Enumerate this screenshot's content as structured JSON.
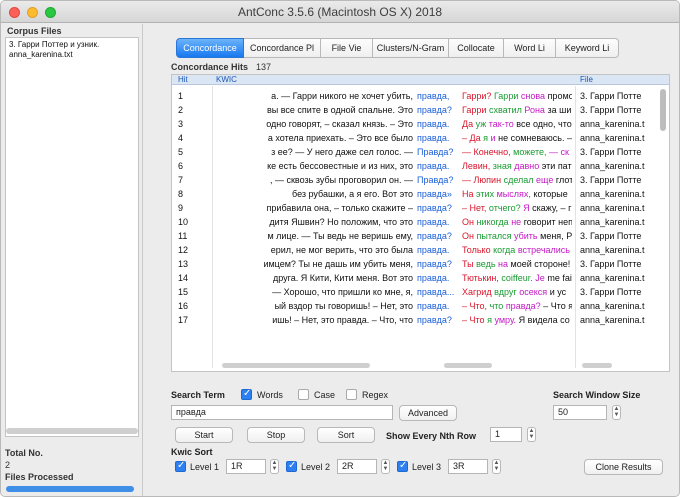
{
  "window": {
    "title": "AntConc 3.5.6 (Macintosh OS X) 2018"
  },
  "corpus": {
    "heading": "Corpus Files",
    "files": [
      "3. Гарри Поттер и узник.",
      "anna_karenina.txt"
    ],
    "total_label": "Total No.",
    "total_value": "2",
    "processed_label": "Files Processed"
  },
  "tabs": [
    {
      "label": "Concordance",
      "active": true
    },
    {
      "label": "Concordance Pl",
      "active": false
    },
    {
      "label": "File Vie",
      "active": false
    },
    {
      "label": "Clusters/N-Gram",
      "active": false
    },
    {
      "label": "Collocate",
      "active": false
    },
    {
      "label": "Word Li",
      "active": false
    },
    {
      "label": "Keyword Li",
      "active": false
    }
  ],
  "hits": {
    "label": "Concordance Hits",
    "count": "137"
  },
  "table": {
    "col_hit": "Hit",
    "col_kwic": "KWIC",
    "col_file": "File",
    "rows": [
      {
        "hit": "1",
        "left": "а. — Гарри никого не хочет убить,",
        "kw": "правда,",
        "right": "Гарри? Гарри снова промо",
        "file": "3. Гарри Потте"
      },
      {
        "hit": "2",
        "left": "вы все спите в одной спальне. Это",
        "kw": "правда?",
        "right": "Гарри схватил Рона за ши",
        "file": "3. Гарри Потте"
      },
      {
        "hit": "3",
        "left": "одно говорят, – сказал князь. – Это",
        "kw": "правда.",
        "right": "Да уж так-то все одно, что",
        "file": "anna_karenina.t"
      },
      {
        "hit": "4",
        "left": "а хотела приехать. – Это все было",
        "kw": "правда.",
        "right": "– Да я и не сомневаюсь. –",
        "file": "anna_karenina.t"
      },
      {
        "hit": "5",
        "left": "з ее? — У него даже сел голос. —",
        "kw": "Правда?",
        "right": "— Конечно, можете, — ск",
        "file": "3. Гарри Потте"
      },
      {
        "hit": "6",
        "left": "ке есть бессовестные и из них, это",
        "kw": "правда.",
        "right": "Левин, зная давно эти пат",
        "file": "anna_karenina.t"
      },
      {
        "hit": "7",
        "left": ", — сквозь зубы проговорил он. —",
        "kw": "Правда?",
        "right": "— Люпин сделал еще глот",
        "file": "3. Гарри Потте"
      },
      {
        "hit": "8",
        "left": "без рубашки, а я его. Вот это",
        "kw": "правда»",
        "right": "На этих мыслях, которые",
        "file": "anna_karenina.t"
      },
      {
        "hit": "9",
        "left": "прибавила она, – только скажите –",
        "kw": "правда?",
        "right": "– Нет, отчего? Я скажу, – г",
        "file": "anna_karenina.t"
      },
      {
        "hit": "10",
        "left": "дитя Яшвин? Но положим, что это",
        "kw": "правда.",
        "right": "Он никогда не говорит неп",
        "file": "anna_karenina.t"
      },
      {
        "hit": "11",
        "left": "м лице. — Ты ведь не веришь ему,",
        "kw": "правда?",
        "right": "Он пытался убить меня, Р",
        "file": "3. Гарри Потте"
      },
      {
        "hit": "12",
        "left": "ерил, не мог верить, что это была",
        "kw": "правда.",
        "right": "Только когда встречались",
        "file": "anna_karenina.t"
      },
      {
        "hit": "13",
        "left": "имцем? Ты не дашь им убить меня,",
        "kw": "правда?",
        "right": "Ты ведь на моей стороне!",
        "file": "3. Гарри Потте"
      },
      {
        "hit": "14",
        "left": "друга. Я Кити, Кити меня. Вот это",
        "kw": "правда.",
        "right": "Тютькин, coiffeur. Je me fai",
        "file": "anna_karenina.t"
      },
      {
        "hit": "15",
        "left": "— Хорошо, что пришли ко мне, я,",
        "kw": "правда...",
        "right": "Хагрид вдруг осекся и ус",
        "file": "3. Гарри Потте"
      },
      {
        "hit": "16",
        "left": "ый вздор ты говоришь! – Нет, это",
        "kw": "правда.",
        "right": "– Что, что правда? – Что я",
        "file": "anna_karenina.t"
      },
      {
        "hit": "17",
        "left": "ишь! – Нет, это правда. – Что, что",
        "kw": "правда?",
        "right": "– Что я умру. Я видела со",
        "file": "anna_karenina.t"
      }
    ]
  },
  "search": {
    "term_label": "Search Term",
    "words_label": "Words",
    "words_checked": true,
    "case_label": "Case",
    "case_checked": false,
    "regex_label": "Regex",
    "regex_checked": false,
    "value": "правда",
    "advanced_label": "Advanced",
    "window_size_label": "Search Window Size",
    "window_size_value": "50",
    "start_label": "Start",
    "stop_label": "Stop",
    "sort_label": "Sort",
    "nth_row_label": "Show Every Nth Row",
    "nth_row_value": "1"
  },
  "kwic_sort": {
    "heading": "Kwic Sort",
    "level1_label": "Level 1",
    "level1_value": "1R",
    "level2_label": "Level 2",
    "level2_value": "2R",
    "level3_label": "Level 3",
    "level3_value": "3R",
    "clone_label": "Clone Results"
  },
  "colors": {
    "keyword": "#1a5ed8",
    "first_right": "#d9152b",
    "second_right": "#1a9b32",
    "third_right": "#c419c4",
    "accent": "#1778f0"
  }
}
